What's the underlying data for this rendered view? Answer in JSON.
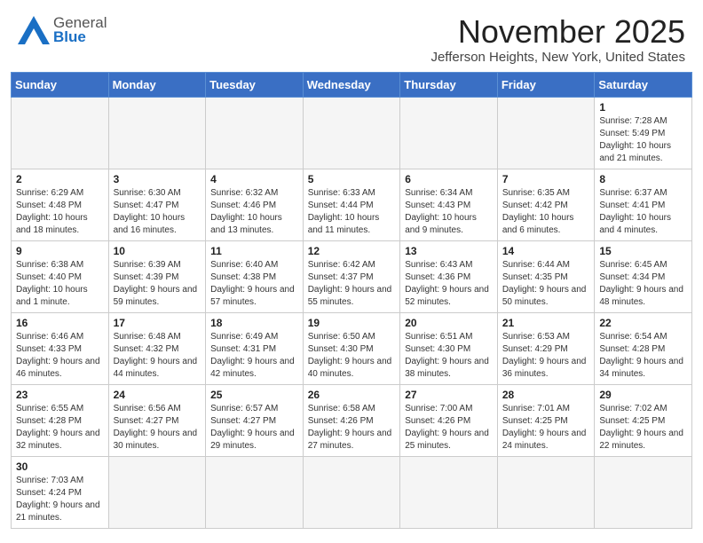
{
  "header": {
    "logo_general": "General",
    "logo_blue": "Blue",
    "month": "November 2025",
    "location": "Jefferson Heights, New York, United States"
  },
  "days_of_week": [
    "Sunday",
    "Monday",
    "Tuesday",
    "Wednesday",
    "Thursday",
    "Friday",
    "Saturday"
  ],
  "weeks": [
    [
      {
        "day": "",
        "info": ""
      },
      {
        "day": "",
        "info": ""
      },
      {
        "day": "",
        "info": ""
      },
      {
        "day": "",
        "info": ""
      },
      {
        "day": "",
        "info": ""
      },
      {
        "day": "",
        "info": ""
      },
      {
        "day": "1",
        "info": "Sunrise: 7:28 AM\nSunset: 5:49 PM\nDaylight: 10 hours and 21 minutes."
      }
    ],
    [
      {
        "day": "2",
        "info": "Sunrise: 6:29 AM\nSunset: 4:48 PM\nDaylight: 10 hours and 18 minutes."
      },
      {
        "day": "3",
        "info": "Sunrise: 6:30 AM\nSunset: 4:47 PM\nDaylight: 10 hours and 16 minutes."
      },
      {
        "day": "4",
        "info": "Sunrise: 6:32 AM\nSunset: 4:46 PM\nDaylight: 10 hours and 13 minutes."
      },
      {
        "day": "5",
        "info": "Sunrise: 6:33 AM\nSunset: 4:44 PM\nDaylight: 10 hours and 11 minutes."
      },
      {
        "day": "6",
        "info": "Sunrise: 6:34 AM\nSunset: 4:43 PM\nDaylight: 10 hours and 9 minutes."
      },
      {
        "day": "7",
        "info": "Sunrise: 6:35 AM\nSunset: 4:42 PM\nDaylight: 10 hours and 6 minutes."
      },
      {
        "day": "8",
        "info": "Sunrise: 6:37 AM\nSunset: 4:41 PM\nDaylight: 10 hours and 4 minutes."
      }
    ],
    [
      {
        "day": "9",
        "info": "Sunrise: 6:38 AM\nSunset: 4:40 PM\nDaylight: 10 hours and 1 minute."
      },
      {
        "day": "10",
        "info": "Sunrise: 6:39 AM\nSunset: 4:39 PM\nDaylight: 9 hours and 59 minutes."
      },
      {
        "day": "11",
        "info": "Sunrise: 6:40 AM\nSunset: 4:38 PM\nDaylight: 9 hours and 57 minutes."
      },
      {
        "day": "12",
        "info": "Sunrise: 6:42 AM\nSunset: 4:37 PM\nDaylight: 9 hours and 55 minutes."
      },
      {
        "day": "13",
        "info": "Sunrise: 6:43 AM\nSunset: 4:36 PM\nDaylight: 9 hours and 52 minutes."
      },
      {
        "day": "14",
        "info": "Sunrise: 6:44 AM\nSunset: 4:35 PM\nDaylight: 9 hours and 50 minutes."
      },
      {
        "day": "15",
        "info": "Sunrise: 6:45 AM\nSunset: 4:34 PM\nDaylight: 9 hours and 48 minutes."
      }
    ],
    [
      {
        "day": "16",
        "info": "Sunrise: 6:46 AM\nSunset: 4:33 PM\nDaylight: 9 hours and 46 minutes."
      },
      {
        "day": "17",
        "info": "Sunrise: 6:48 AM\nSunset: 4:32 PM\nDaylight: 9 hours and 44 minutes."
      },
      {
        "day": "18",
        "info": "Sunrise: 6:49 AM\nSunset: 4:31 PM\nDaylight: 9 hours and 42 minutes."
      },
      {
        "day": "19",
        "info": "Sunrise: 6:50 AM\nSunset: 4:30 PM\nDaylight: 9 hours and 40 minutes."
      },
      {
        "day": "20",
        "info": "Sunrise: 6:51 AM\nSunset: 4:30 PM\nDaylight: 9 hours and 38 minutes."
      },
      {
        "day": "21",
        "info": "Sunrise: 6:53 AM\nSunset: 4:29 PM\nDaylight: 9 hours and 36 minutes."
      },
      {
        "day": "22",
        "info": "Sunrise: 6:54 AM\nSunset: 4:28 PM\nDaylight: 9 hours and 34 minutes."
      }
    ],
    [
      {
        "day": "23",
        "info": "Sunrise: 6:55 AM\nSunset: 4:28 PM\nDaylight: 9 hours and 32 minutes."
      },
      {
        "day": "24",
        "info": "Sunrise: 6:56 AM\nSunset: 4:27 PM\nDaylight: 9 hours and 30 minutes."
      },
      {
        "day": "25",
        "info": "Sunrise: 6:57 AM\nSunset: 4:27 PM\nDaylight: 9 hours and 29 minutes."
      },
      {
        "day": "26",
        "info": "Sunrise: 6:58 AM\nSunset: 4:26 PM\nDaylight: 9 hours and 27 minutes."
      },
      {
        "day": "27",
        "info": "Sunrise: 7:00 AM\nSunset: 4:26 PM\nDaylight: 9 hours and 25 minutes."
      },
      {
        "day": "28",
        "info": "Sunrise: 7:01 AM\nSunset: 4:25 PM\nDaylight: 9 hours and 24 minutes."
      },
      {
        "day": "29",
        "info": "Sunrise: 7:02 AM\nSunset: 4:25 PM\nDaylight: 9 hours and 22 minutes."
      }
    ],
    [
      {
        "day": "30",
        "info": "Sunrise: 7:03 AM\nSunset: 4:24 PM\nDaylight: 9 hours and 21 minutes."
      },
      {
        "day": "",
        "info": ""
      },
      {
        "day": "",
        "info": ""
      },
      {
        "day": "",
        "info": ""
      },
      {
        "day": "",
        "info": ""
      },
      {
        "day": "",
        "info": ""
      },
      {
        "day": "",
        "info": ""
      }
    ]
  ]
}
